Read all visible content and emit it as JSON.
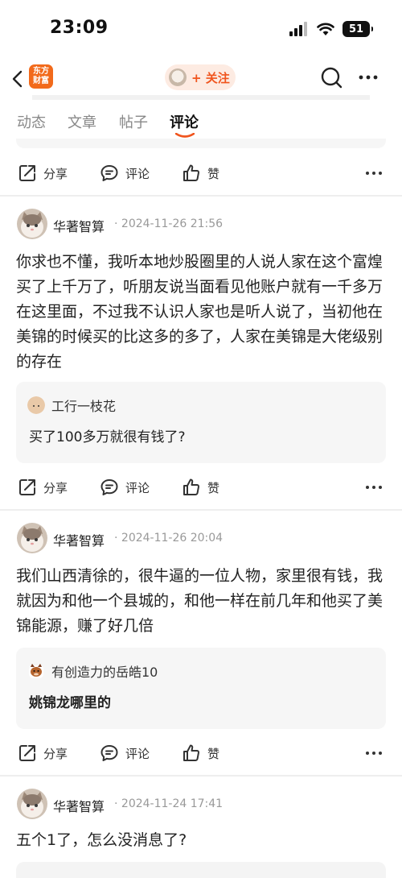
{
  "status_bar": {
    "time": "23:09",
    "battery": "51"
  },
  "nav": {
    "logo_line1": "东方",
    "logo_line2": "财富",
    "follow_label": "+ 关注",
    "colors": {
      "accent": "#f0551e",
      "logo": "#f26a1b",
      "pill_bg": "#fdebe2"
    }
  },
  "tabs": [
    {
      "label": "动态"
    },
    {
      "label": "文章"
    },
    {
      "label": "帖子"
    },
    {
      "label": "评论",
      "active": true
    }
  ],
  "actions": {
    "share": "分享",
    "comment": "评论",
    "like": "赞"
  },
  "posts": [
    {
      "username": "华著智算",
      "timestamp": "2024-11-26 21:56",
      "body": "你求也不懂，我听本地炒股圈里的人说人家在这个富煌买了上千万了，听朋友说当面看见他账户就有一千多万在这里面，不过我不认识人家也是听人说了，当初他在美锦的时候买的比这多的多了，人家在美锦是大佬级别的存在",
      "quote": {
        "user": "工行一枝花",
        "text": "买了100多万就很有钱了?"
      }
    },
    {
      "username": "华著智算",
      "timestamp": "2024-11-26 20:04",
      "body": "我们山西清徐的，很牛逼的一位人物，家里很有钱，我就因为和他一个县城的，和他一样在前几年和他买了美锦能源，赚了好几倍",
      "quote": {
        "user": "有创造力的岳皓10",
        "text": "姚锦龙哪里的"
      }
    },
    {
      "username": "华著智算",
      "timestamp": "2024-11-24 17:41",
      "body": "五个1了，怎么没消息了?"
    }
  ]
}
